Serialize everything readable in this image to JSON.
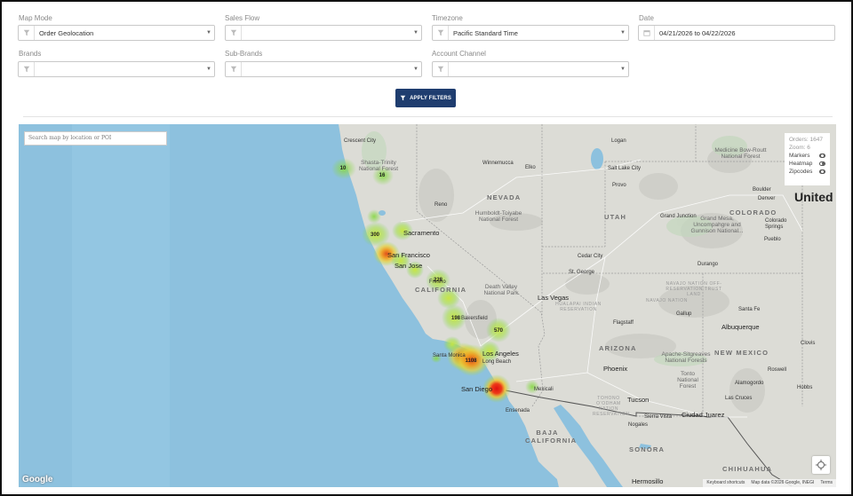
{
  "filters": {
    "map_mode": {
      "label": "Map Mode",
      "value": "Order Geolocation"
    },
    "sales_flow": {
      "label": "Sales Flow",
      "value": ""
    },
    "timezone": {
      "label": "Timezone",
      "value": "Pacific Standard Time"
    },
    "date": {
      "label": "Date",
      "value": "04/21/2026 to 04/22/2026"
    },
    "brands": {
      "label": "Brands",
      "value": ""
    },
    "sub_brands": {
      "label": "Sub-Brands",
      "value": ""
    },
    "account_channel": {
      "label": "Account Channel",
      "value": ""
    },
    "apply_label": "APPLY FILTERS"
  },
  "map": {
    "search_placeholder": "Search map by location or POI",
    "panel": {
      "orders": "Orders: 1647",
      "zoom": "Zoom: 6",
      "markers_label": "Markers",
      "heatmap_label": "Heatmap",
      "zipcodes_label": "Zipcodes",
      "markers_on": false,
      "heatmap_on": true,
      "zipcodes_on": false
    },
    "clusters": [
      {
        "count": "10"
      },
      {
        "count": "16"
      },
      {
        "count": "300"
      },
      {
        "count": "228"
      },
      {
        "count": "198"
      },
      {
        "count": "570"
      },
      {
        "count": "1108"
      }
    ],
    "states": [
      "NEVADA",
      "UTAH",
      "COLORADO",
      "CALIFORNIA",
      "ARIZONA",
      "NEW MEXICO",
      "BAJA CALIFORNIA",
      "SONORA",
      "CHIHUAHUA"
    ],
    "country": "United",
    "cities": [
      "Crescent City",
      "Logan",
      "Winnemucca",
      "Elko",
      "Salt Lake City",
      "Provo",
      "Boulder",
      "Denver",
      "Reno",
      "Sacramento",
      "San Francisco",
      "San Jose",
      "Fresno",
      "Bakersfield",
      "Las Vegas",
      "Los Angeles",
      "Santa Monica",
      "Long Beach",
      "San Diego",
      "Mexicali",
      "Ensenada",
      "Phoenix",
      "Tucson",
      "Flagstaff",
      "St. George",
      "Cedar City",
      "Santa Fe",
      "Albuquerque",
      "Gallup",
      "Durango",
      "Grand Junction",
      "Colorado Springs",
      "Pueblo",
      "Alamogordo",
      "Las Cruces",
      "Roswell",
      "Hobbs",
      "Ciudad Juarez",
      "Sierra Vista",
      "Nogales",
      "Hermosillo",
      "Clovis"
    ],
    "parks": [
      "Shasta-Trinity National Forest",
      "Humboldt-Toiyabe National Forest",
      "Death Valley National Park",
      "Medicine Bow-Routt National Forest",
      "Grand Mesa, Uncompahgre and Gunnison National...",
      "Apache-Sitgreaves National Forests",
      "Tonto National Forest"
    ],
    "reservations": [
      "NAVAJO NATION OFF-RESERVATION TRUST LAND",
      "NAVAJO NATION",
      "HUALAPAI INDIAN RESERVATION",
      "TOHONO O'ODHAM NATION RESERVATION"
    ],
    "google_logo": "Google",
    "attribution": [
      "Keyboard shortcuts",
      "Map data ©2026 Google, INEGI",
      "Terms"
    ]
  }
}
